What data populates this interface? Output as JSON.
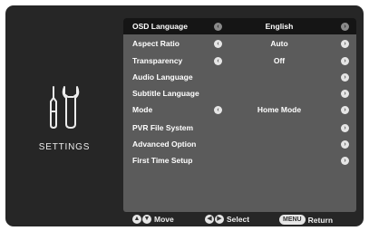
{
  "sidebar": {
    "title": "SETTINGS"
  },
  "menu": {
    "items": [
      {
        "label": "OSD Language",
        "value": "English",
        "selected": true,
        "arrows": true
      },
      {
        "label": "Aspect Ratio",
        "value": "Auto",
        "arrows": true
      },
      {
        "label": "Transparency",
        "value": "Off",
        "arrows": true
      },
      {
        "label": "Audio Language",
        "value": "",
        "arrows": false
      },
      {
        "label": "Subtitle Language",
        "value": "",
        "arrows": false
      },
      {
        "label": "Mode",
        "value": "Home Mode",
        "arrows": true
      },
      {
        "label": "PVR File System",
        "value": "",
        "arrows": false
      },
      {
        "label": "Advanced Option",
        "value": "",
        "arrows": false
      },
      {
        "label": "First Time Setup",
        "value": "",
        "arrows": false
      }
    ]
  },
  "footer": {
    "move_label": "Move",
    "select_label": "Select",
    "menu_key": "MENU",
    "return_label": "Return"
  },
  "icons": {
    "tools": "wrench-screwdriver-icon",
    "left_arrow": "chevron-left-icon",
    "right_arrow": "chevron-right-icon",
    "up_down": "up-down-arrows-icon"
  },
  "colors": {
    "screen_bg": "#262626",
    "panel_bg": "#5b5b5b",
    "selected_row_bg": "#151515",
    "text": "#ffffff"
  }
}
